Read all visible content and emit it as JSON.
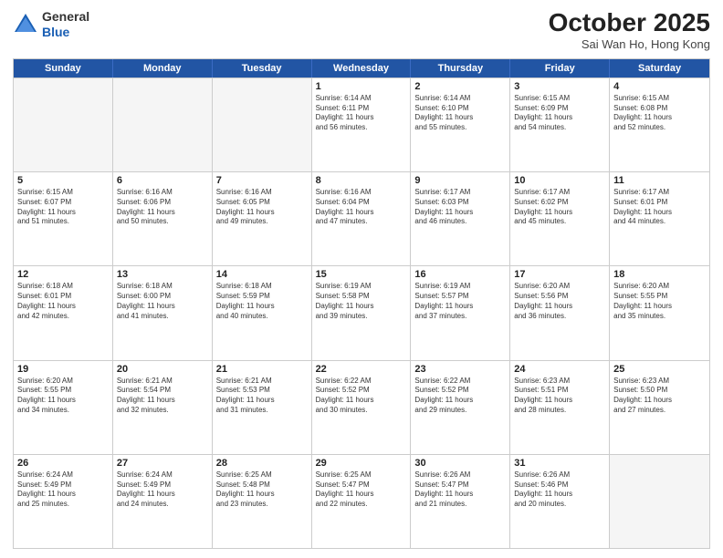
{
  "header": {
    "logo_line1": "General",
    "logo_line2": "Blue",
    "title": "October 2025",
    "subtitle": "Sai Wan Ho, Hong Kong"
  },
  "weekdays": [
    "Sunday",
    "Monday",
    "Tuesday",
    "Wednesday",
    "Thursday",
    "Friday",
    "Saturday"
  ],
  "weeks": [
    [
      {
        "day": "",
        "info": ""
      },
      {
        "day": "",
        "info": ""
      },
      {
        "day": "",
        "info": ""
      },
      {
        "day": "1",
        "info": "Sunrise: 6:14 AM\nSunset: 6:11 PM\nDaylight: 11 hours\nand 56 minutes."
      },
      {
        "day": "2",
        "info": "Sunrise: 6:14 AM\nSunset: 6:10 PM\nDaylight: 11 hours\nand 55 minutes."
      },
      {
        "day": "3",
        "info": "Sunrise: 6:15 AM\nSunset: 6:09 PM\nDaylight: 11 hours\nand 54 minutes."
      },
      {
        "day": "4",
        "info": "Sunrise: 6:15 AM\nSunset: 6:08 PM\nDaylight: 11 hours\nand 52 minutes."
      }
    ],
    [
      {
        "day": "5",
        "info": "Sunrise: 6:15 AM\nSunset: 6:07 PM\nDaylight: 11 hours\nand 51 minutes."
      },
      {
        "day": "6",
        "info": "Sunrise: 6:16 AM\nSunset: 6:06 PM\nDaylight: 11 hours\nand 50 minutes."
      },
      {
        "day": "7",
        "info": "Sunrise: 6:16 AM\nSunset: 6:05 PM\nDaylight: 11 hours\nand 49 minutes."
      },
      {
        "day": "8",
        "info": "Sunrise: 6:16 AM\nSunset: 6:04 PM\nDaylight: 11 hours\nand 47 minutes."
      },
      {
        "day": "9",
        "info": "Sunrise: 6:17 AM\nSunset: 6:03 PM\nDaylight: 11 hours\nand 46 minutes."
      },
      {
        "day": "10",
        "info": "Sunrise: 6:17 AM\nSunset: 6:02 PM\nDaylight: 11 hours\nand 45 minutes."
      },
      {
        "day": "11",
        "info": "Sunrise: 6:17 AM\nSunset: 6:01 PM\nDaylight: 11 hours\nand 44 minutes."
      }
    ],
    [
      {
        "day": "12",
        "info": "Sunrise: 6:18 AM\nSunset: 6:01 PM\nDaylight: 11 hours\nand 42 minutes."
      },
      {
        "day": "13",
        "info": "Sunrise: 6:18 AM\nSunset: 6:00 PM\nDaylight: 11 hours\nand 41 minutes."
      },
      {
        "day": "14",
        "info": "Sunrise: 6:18 AM\nSunset: 5:59 PM\nDaylight: 11 hours\nand 40 minutes."
      },
      {
        "day": "15",
        "info": "Sunrise: 6:19 AM\nSunset: 5:58 PM\nDaylight: 11 hours\nand 39 minutes."
      },
      {
        "day": "16",
        "info": "Sunrise: 6:19 AM\nSunset: 5:57 PM\nDaylight: 11 hours\nand 37 minutes."
      },
      {
        "day": "17",
        "info": "Sunrise: 6:20 AM\nSunset: 5:56 PM\nDaylight: 11 hours\nand 36 minutes."
      },
      {
        "day": "18",
        "info": "Sunrise: 6:20 AM\nSunset: 5:55 PM\nDaylight: 11 hours\nand 35 minutes."
      }
    ],
    [
      {
        "day": "19",
        "info": "Sunrise: 6:20 AM\nSunset: 5:55 PM\nDaylight: 11 hours\nand 34 minutes."
      },
      {
        "day": "20",
        "info": "Sunrise: 6:21 AM\nSunset: 5:54 PM\nDaylight: 11 hours\nand 32 minutes."
      },
      {
        "day": "21",
        "info": "Sunrise: 6:21 AM\nSunset: 5:53 PM\nDaylight: 11 hours\nand 31 minutes."
      },
      {
        "day": "22",
        "info": "Sunrise: 6:22 AM\nSunset: 5:52 PM\nDaylight: 11 hours\nand 30 minutes."
      },
      {
        "day": "23",
        "info": "Sunrise: 6:22 AM\nSunset: 5:52 PM\nDaylight: 11 hours\nand 29 minutes."
      },
      {
        "day": "24",
        "info": "Sunrise: 6:23 AM\nSunset: 5:51 PM\nDaylight: 11 hours\nand 28 minutes."
      },
      {
        "day": "25",
        "info": "Sunrise: 6:23 AM\nSunset: 5:50 PM\nDaylight: 11 hours\nand 27 minutes."
      }
    ],
    [
      {
        "day": "26",
        "info": "Sunrise: 6:24 AM\nSunset: 5:49 PM\nDaylight: 11 hours\nand 25 minutes."
      },
      {
        "day": "27",
        "info": "Sunrise: 6:24 AM\nSunset: 5:49 PM\nDaylight: 11 hours\nand 24 minutes."
      },
      {
        "day": "28",
        "info": "Sunrise: 6:25 AM\nSunset: 5:48 PM\nDaylight: 11 hours\nand 23 minutes."
      },
      {
        "day": "29",
        "info": "Sunrise: 6:25 AM\nSunset: 5:47 PM\nDaylight: 11 hours\nand 22 minutes."
      },
      {
        "day": "30",
        "info": "Sunrise: 6:26 AM\nSunset: 5:47 PM\nDaylight: 11 hours\nand 21 minutes."
      },
      {
        "day": "31",
        "info": "Sunrise: 6:26 AM\nSunset: 5:46 PM\nDaylight: 11 hours\nand 20 minutes."
      },
      {
        "day": "",
        "info": ""
      }
    ]
  ]
}
